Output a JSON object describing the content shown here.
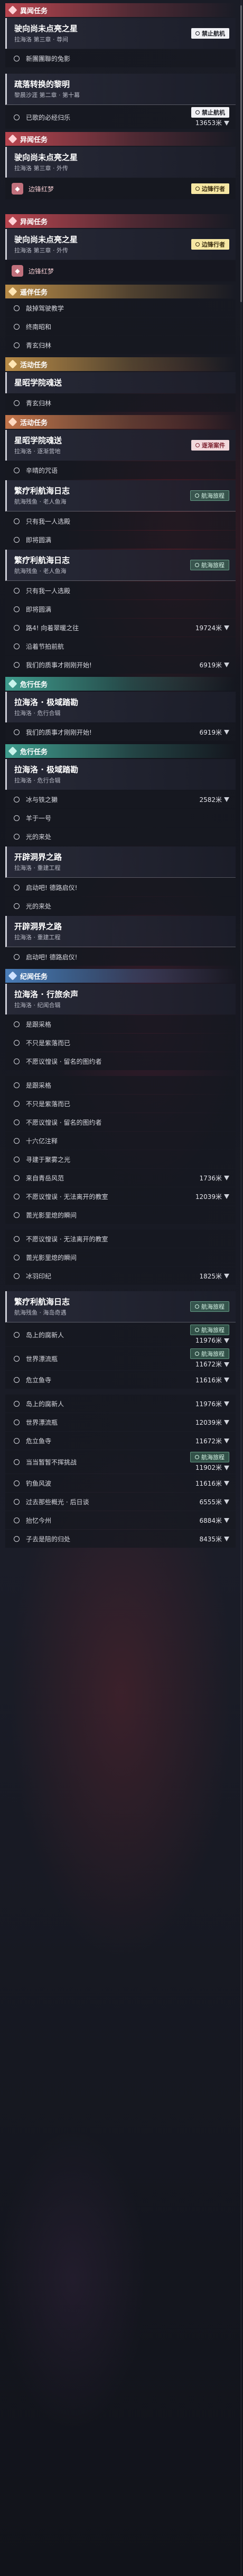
{
  "sections": [
    {
      "kind": "category",
      "color": "red",
      "label": "異闻任务"
    },
    {
      "kind": "card",
      "title": "驶向尚未点亮之星",
      "sub": "拉海洛 第三章 · 尊间",
      "tag": {
        "style": "white",
        "text": "禁止航机"
      }
    },
    {
      "kind": "obj",
      "text": "新團團聯的兔影"
    },
    {
      "kind": "gap"
    },
    {
      "kind": "card",
      "title": "疏落转换的黎明",
      "sub": "黎晨沙涯 第二章 · 第十幕",
      "bar": true
    },
    {
      "kind": "obj",
      "text": "已歌的必经归乐",
      "dist": "13653米",
      "tag": {
        "style": "white",
        "text": "禁止航机"
      }
    },
    {
      "kind": "category",
      "color": "red",
      "label": "异闻任务"
    },
    {
      "kind": "card",
      "title": "驶向尚未点亮之星",
      "sub": "拉海洛 第三章 · 外传"
    },
    {
      "kind": "special",
      "label": "边锋红梦",
      "tag": {
        "style": "yellow",
        "text": "边锋行者"
      }
    },
    {
      "kind": "gap-l"
    },
    {
      "kind": "category",
      "color": "red",
      "label": "异闻任务"
    },
    {
      "kind": "card",
      "title": "驶向尚未点亮之星",
      "sub": "拉海洛 第三章 · 外传",
      "tag": {
        "style": "yellow",
        "text": "边锋行者"
      }
    },
    {
      "kind": "special",
      "label": "边锋红梦"
    },
    {
      "kind": "category",
      "color": "gold",
      "label": "遥伴任务"
    },
    {
      "kind": "obj",
      "text": "敲掉驾驶教学"
    },
    {
      "kind": "obj",
      "text": "终南昭和"
    },
    {
      "kind": "obj",
      "text": "青玄归林"
    },
    {
      "kind": "category",
      "color": "gold",
      "label": "活动任务"
    },
    {
      "kind": "card",
      "title": "星昭学院魂送",
      "sub": ""
    },
    {
      "kind": "obj",
      "text": "青玄归林"
    },
    {
      "kind": "category",
      "color": "orange",
      "label": "活动任务"
    },
    {
      "kind": "card",
      "title": "星昭学院魂送",
      "sub": "拉海洛 · 逐渐营地",
      "tag": {
        "style": "red",
        "text": "逐渐案件"
      }
    },
    {
      "kind": "obj",
      "text": "辛晴的咒语"
    },
    {
      "kind": "card",
      "title": "繁疗利航海日志",
      "sub": "航海残鱼 · 老人鱼海",
      "bar": true,
      "tag": {
        "style": "green",
        "text": "航海旅程"
      }
    },
    {
      "kind": "obj",
      "text": "只有我一人选殿"
    },
    {
      "kind": "obj",
      "text": "即将圆满"
    },
    {
      "kind": "card",
      "title": "繁疗利航海日志",
      "sub": "航海残鱼 · 老人鱼海",
      "bar": true,
      "tag": {
        "style": "green",
        "text": "航海旅程"
      }
    },
    {
      "kind": "obj",
      "text": "只有我一人选殿"
    },
    {
      "kind": "obj",
      "text": "即将圆满"
    },
    {
      "kind": "obj",
      "text": "路4! 向着翠暖之往",
      "dist": "19724米"
    },
    {
      "kind": "obj",
      "text": "沿着节拍前航"
    },
    {
      "kind": "obj",
      "text": "我们的质事才刚刚开始!",
      "dist": "6919米"
    },
    {
      "kind": "category",
      "color": "teal",
      "label": "危行任务"
    },
    {
      "kind": "card",
      "title": "拉海洛 · 极域踏勘",
      "sub": "拉海洛 · 危行合辑"
    },
    {
      "kind": "obj",
      "text": "我们的质事才刚刚开始!",
      "dist": "6919米"
    },
    {
      "kind": "category",
      "color": "teal",
      "label": "危行任务"
    },
    {
      "kind": "card",
      "title": "拉海洛 · 极域踏勘",
      "sub": "拉海洛 · 危行合辑"
    },
    {
      "kind": "obj",
      "text": "冰与铁之獭",
      "dist": "2582米"
    },
    {
      "kind": "obj",
      "text": "羊于一号"
    },
    {
      "kind": "obj",
      "text": "光的来处"
    },
    {
      "kind": "card",
      "title": "开辟洞界之路",
      "sub": "拉海洛 · 重建工程",
      "bar": true
    },
    {
      "kind": "obj",
      "text": "启动吧! 德路启仪!"
    },
    {
      "kind": "obj",
      "text": "光的来处"
    },
    {
      "kind": "card",
      "title": "开辟洞界之路",
      "sub": "拉海洛 · 重建工程",
      "bar": true
    },
    {
      "kind": "obj",
      "text": "启动吧! 德路启仪!"
    },
    {
      "kind": "category",
      "color": "blue",
      "label": "纪闻任务"
    },
    {
      "kind": "card",
      "title": "拉海洛 · 行旅余声",
      "sub": "拉海洛 · 纪闻合辑"
    },
    {
      "kind": "obj",
      "text": "是跟采格"
    },
    {
      "kind": "obj",
      "text": "不只是紫落而已"
    },
    {
      "kind": "obj",
      "text": "不愿议惶误 · 留名的图约者"
    },
    {
      "kind": "gap"
    },
    {
      "kind": "obj",
      "text": "是跟采格"
    },
    {
      "kind": "obj",
      "text": "不只是紫落而已"
    },
    {
      "kind": "obj",
      "text": "不愿议惶误 · 留名的图约者"
    },
    {
      "kind": "obj",
      "text": "十六亿注释"
    },
    {
      "kind": "obj",
      "text": "寻建于聚雾之光"
    },
    {
      "kind": "obj",
      "text": "来自青岳风范",
      "dist": "1736米"
    },
    {
      "kind": "obj",
      "text": "不愿议惶误 · 无法离开的教室",
      "dist": "12039米"
    },
    {
      "kind": "obj",
      "text": "蓖光影里熄的瞬间"
    },
    {
      "kind": "gap"
    },
    {
      "kind": "obj",
      "text": "不愿议惶误 · 无法离开的教室"
    },
    {
      "kind": "obj",
      "text": "蓖光影里熄的瞬间"
    },
    {
      "kind": "obj",
      "text": "冰羽印纪",
      "dist": "1825米"
    },
    {
      "kind": "gap"
    },
    {
      "kind": "card",
      "title": "繁疗利航海日志",
      "sub": "航海残鱼 · 海岛奇遇",
      "bar": true,
      "tag": {
        "style": "green",
        "text": "航海旅程"
      }
    },
    {
      "kind": "obj",
      "text": "岛上的腐新人",
      "dist": "11976米",
      "tag": {
        "style": "green",
        "text": "航海旅程"
      }
    },
    {
      "kind": "obj",
      "text": "世界漂流瓶",
      "dist": "11672米",
      "tag": {
        "style": "green",
        "text": "航海旅程"
      }
    },
    {
      "kind": "obj",
      "text": "危立鱼寺",
      "dist": "11616米"
    },
    {
      "kind": "gap"
    },
    {
      "kind": "obj",
      "text": "岛上的腐新人",
      "dist": "11976米"
    },
    {
      "kind": "obj",
      "text": "世界漂流瓶",
      "dist": "12039米"
    },
    {
      "kind": "obj",
      "text": "危立鱼寺",
      "dist": "11672米"
    },
    {
      "kind": "obj",
      "text": "当当暂暂不挥挑战",
      "dist": "11902米",
      "tag": {
        "style": "green",
        "text": "航海旅程"
      }
    },
    {
      "kind": "obj",
      "text": "钓鱼风波",
      "dist": "11616米"
    },
    {
      "kind": "obj",
      "text": "过去那些概光 · 后日谈",
      "dist": "6555米"
    },
    {
      "kind": "obj",
      "text": "抬忆今州",
      "dist": "6884米"
    },
    {
      "kind": "obj",
      "text": "子去是陪的归处",
      "dist": "8435米"
    }
  ],
  "colors": {
    "red": "#b8454f",
    "gold": "#b88b47",
    "orange": "#c2744a",
    "teal": "#3f9c8d",
    "blue": "#4a7db8"
  }
}
